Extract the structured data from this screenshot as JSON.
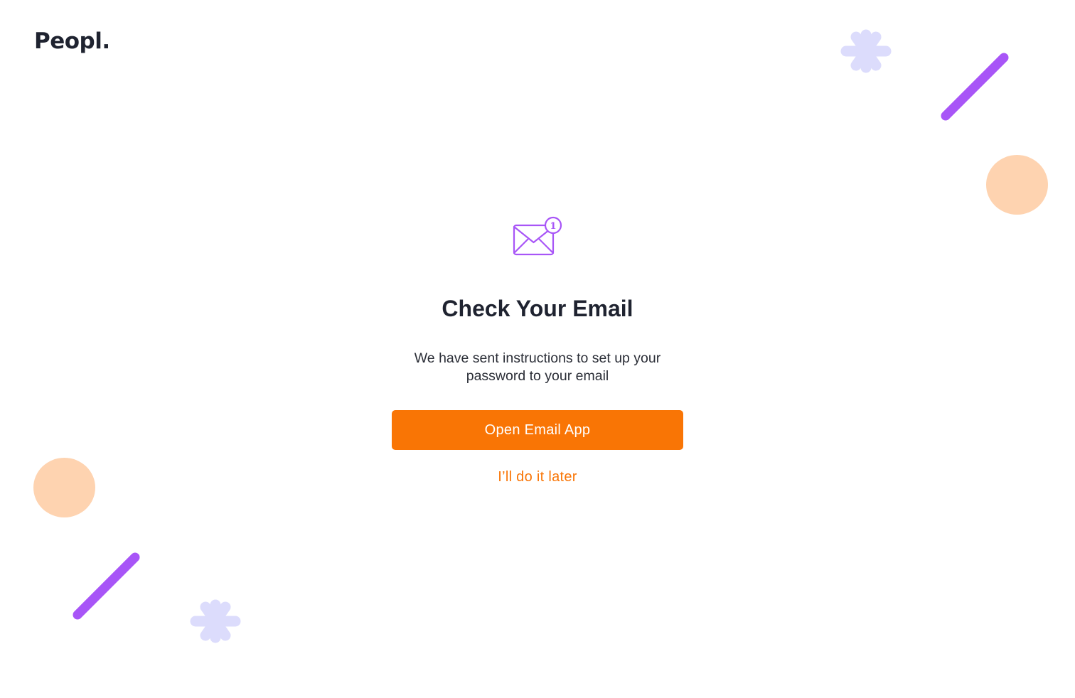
{
  "brand": {
    "logo_text": "Peopl."
  },
  "main": {
    "title": "Check Your Email",
    "description_line1": "We have sent instructions to set up your",
    "description_line2": "password to your email",
    "primary_button_label": "Open Email App",
    "secondary_link_label": "I’ll do it later",
    "notification_count": "1"
  },
  "icons": {
    "mail": "mail-notification-icon",
    "asterisk": "asterisk-shape",
    "slash": "slash-line-shape",
    "circle": "circle-shape"
  },
  "colors": {
    "accent": "#f97505",
    "purple": "#a855f7",
    "lavender": "#dcdcfc",
    "peach": "#fed3b0",
    "text_dark": "#1f2330"
  }
}
